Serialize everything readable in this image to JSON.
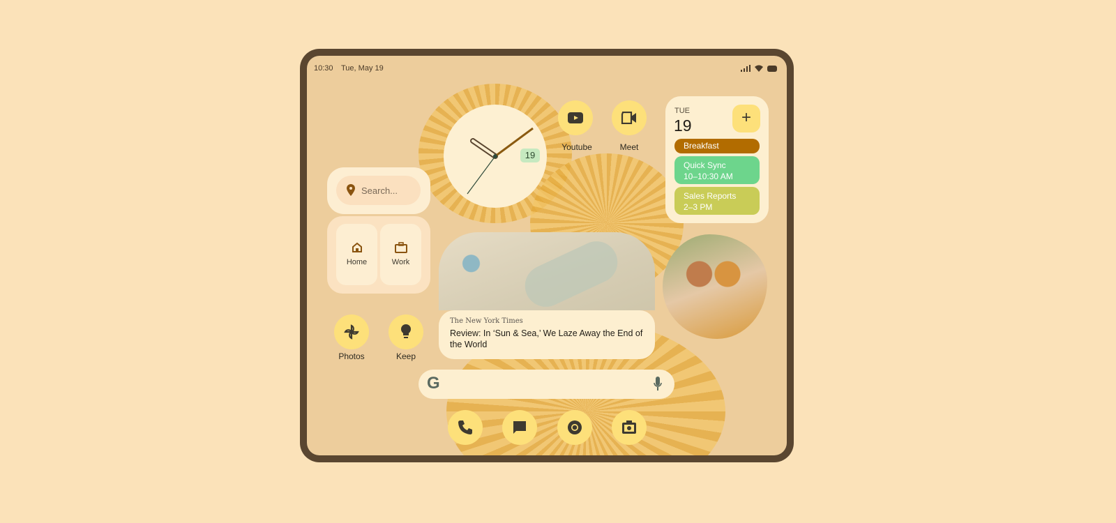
{
  "status": {
    "time": "10:30",
    "date": "Tue, May 19",
    "icons": [
      "signal-icon",
      "wifi-icon",
      "battery-icon"
    ]
  },
  "clock": {
    "date_badge": "19",
    "hour": 10,
    "minute": 8
  },
  "apps": {
    "youtube": "Youtube",
    "meet": "Meet",
    "photos": "Photos",
    "keep": "Keep"
  },
  "calendar": {
    "day": "TUE",
    "date": "19",
    "events": [
      {
        "title": "Breakfast",
        "time": "",
        "color": "#b26c00"
      },
      {
        "title": "Quick Sync",
        "time": "10–10:30 AM",
        "color": "#6dd58c"
      },
      {
        "title": "Sales Reports",
        "time": "2–3 PM",
        "color": "#c9cc57"
      }
    ]
  },
  "maps": {
    "search_placeholder": "Search...",
    "home": "Home",
    "work": "Work"
  },
  "news": {
    "source": "The New York Times",
    "headline": "Review: In ‘Sun & Sea,’ We Laze Away the End of the World"
  },
  "dock": [
    "phone-icon",
    "messages-icon",
    "chrome-icon",
    "camera-icon"
  ],
  "colors": {
    "frame": "#5a4630",
    "wallpaper": "#edcd9c",
    "accent": "#fde07a",
    "background": "#fbe2b9"
  }
}
